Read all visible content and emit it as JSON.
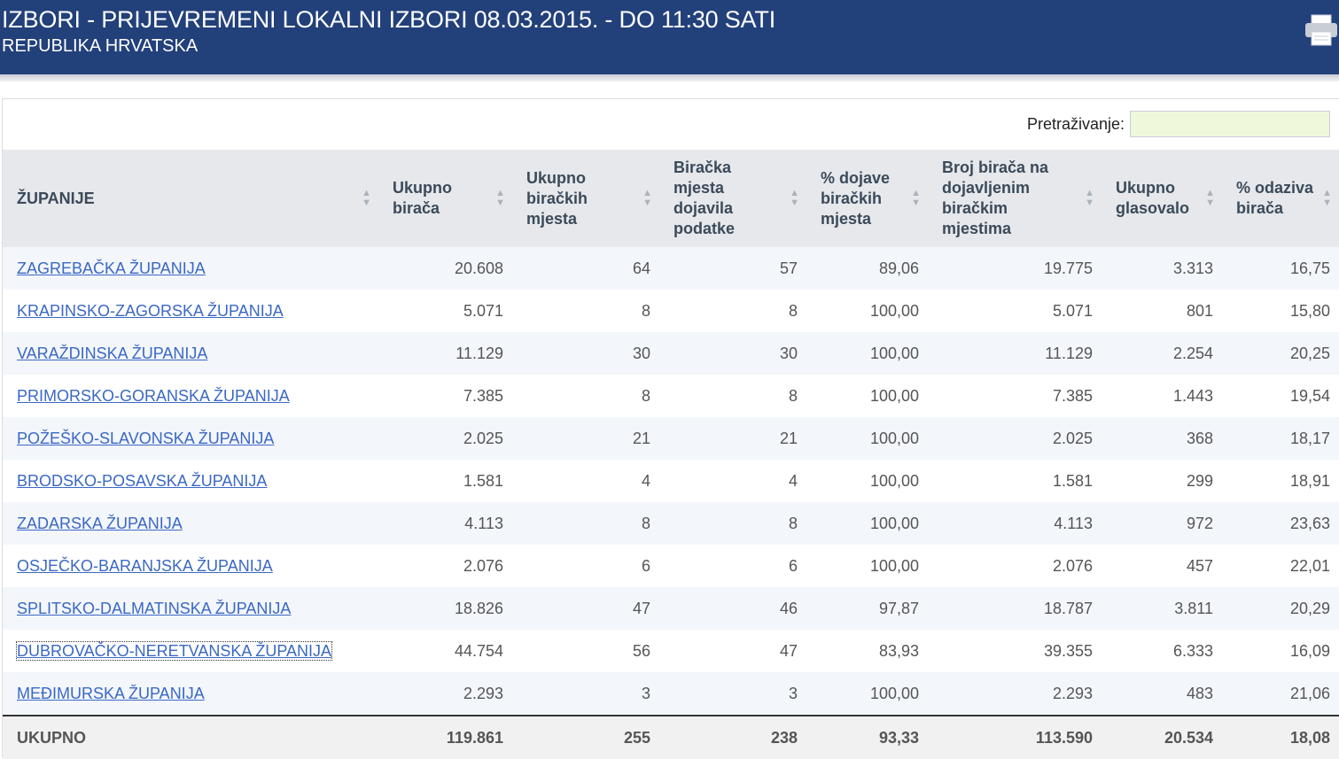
{
  "header": {
    "title": "IZBORI - PRIJEVREMENI LOKALNI IZBORI 08.03.2015. - DO 11:30 SATI",
    "subtitle": "REPUBLIKA HRVATSKA",
    "print_icon": "printer-icon"
  },
  "search": {
    "label": "Pretraživanje:",
    "value": "",
    "placeholder": ""
  },
  "table": {
    "columns": [
      "ŽUPANIJE",
      "Ukupno birača",
      "Ukupno biračkih mjesta",
      "Biračka mjesta dojavila podatke",
      "% dojave biračkih mjesta",
      "Broj birača na dojavljenim biračkim mjestima",
      "Ukupno glasovalo",
      "% odaziva birača"
    ],
    "rows": [
      [
        "ZAGREBAČKA ŽUPANIJA",
        "20.608",
        "64",
        "57",
        "89,06",
        "19.775",
        "3.313",
        "16,75"
      ],
      [
        "KRAPINSKO-ZAGORSKA ŽUPANIJA",
        "5.071",
        "8",
        "8",
        "100,00",
        "5.071",
        "801",
        "15,80"
      ],
      [
        "VARAŽDINSKA ŽUPANIJA",
        "11.129",
        "30",
        "30",
        "100,00",
        "11.129",
        "2.254",
        "20,25"
      ],
      [
        "PRIMORSKO-GORANSKA ŽUPANIJA",
        "7.385",
        "8",
        "8",
        "100,00",
        "7.385",
        "1.443",
        "19,54"
      ],
      [
        "POŽEŠKO-SLAVONSKA ŽUPANIJA",
        "2.025",
        "21",
        "21",
        "100,00",
        "2.025",
        "368",
        "18,17"
      ],
      [
        "BRODSKO-POSAVSKA ŽUPANIJA",
        "1.581",
        "4",
        "4",
        "100,00",
        "1.581",
        "299",
        "18,91"
      ],
      [
        "ZADARSKA ŽUPANIJA",
        "4.113",
        "8",
        "8",
        "100,00",
        "4.113",
        "972",
        "23,63"
      ],
      [
        "OSJEČKO-BARANJSKA ŽUPANIJA",
        "2.076",
        "6",
        "6",
        "100,00",
        "2.076",
        "457",
        "22,01"
      ],
      [
        "SPLITSKO-DALMATINSKA ŽUPANIJA",
        "18.826",
        "47",
        "46",
        "97,87",
        "18.787",
        "3.811",
        "20,29"
      ],
      [
        "DUBROVAČKO-NERETVANSKA ŽUPANIJA",
        "44.754",
        "56",
        "47",
        "83,93",
        "39.355",
        "6.333",
        "16,09"
      ],
      [
        "MEĐIMURSKA ŽUPANIJA",
        "2.293",
        "3",
        "3",
        "100,00",
        "2.293",
        "483",
        "21,06"
      ]
    ],
    "total": [
      "UKUPNO",
      "119.861",
      "255",
      "238",
      "93,33",
      "113.590",
      "20.534",
      "18,08"
    ]
  }
}
